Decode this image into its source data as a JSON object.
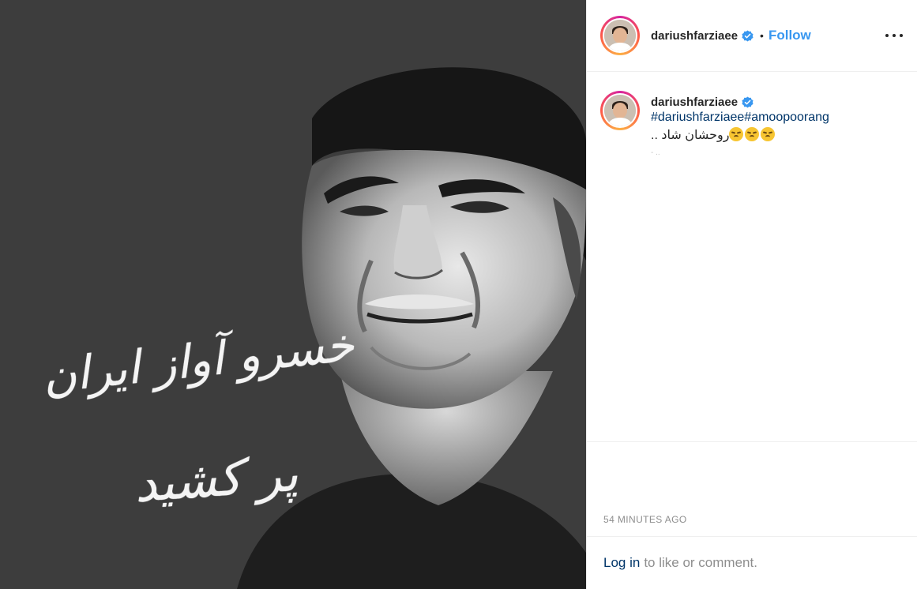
{
  "media": {
    "overlay_line_1": "خسرو آواز ایران",
    "overlay_line_2": "پر کشید",
    "alt": ""
  },
  "header": {
    "username": "dariushfarziaee",
    "separator": "•",
    "follow_label": "Follow"
  },
  "comment": {
    "username": "dariushfarziaee",
    "hashtags": "#dariushfarziaee#amoopoorang",
    "caption_text": "روحشان شاد ..",
    "faint_text": "- .."
  },
  "meta": {
    "timestamp": "54 MINUTES AGO"
  },
  "footer": {
    "login_label": "Log in",
    "rest_text": "to like or comment."
  },
  "colors": {
    "link_blue": "#3897f0",
    "hashtag_navy": "#003569",
    "verified_blue": "#3897f0"
  },
  "icons": [
    "verified-badge-icon",
    "more-options-icon",
    "sad-emoji-icon"
  ]
}
